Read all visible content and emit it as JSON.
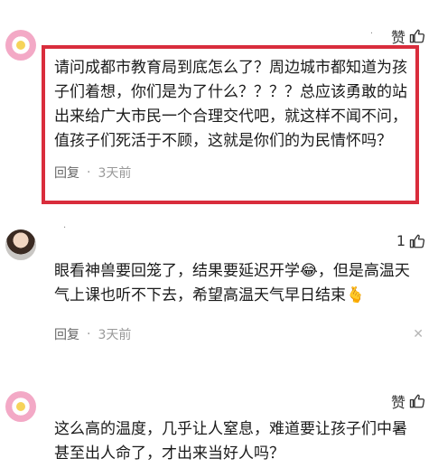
{
  "comments": [
    {
      "like_label": "赞",
      "text_lines": [
        "请问成都市教育局到底怎么了？周边城市都知道为孩",
        "子们着想，你们是为了什么？？？？总应该勇敢的站",
        "出来给广大市民一个合理交代吧，就这样不闻不问，",
        "值孩子们死活于不顾，这就是你们的为民情怀吗？"
      ],
      "reply_label": "回复",
      "dot": "·",
      "time": "3天前"
    },
    {
      "like_label": "1",
      "text_lines": [
        "眼看神兽要回笼了，结果要延迟开学😂，但是高温天",
        "气上课也听不下去，希望高温天气早日结束🫰"
      ],
      "reply_label": "回复",
      "dot": "·",
      "time": "3天前",
      "close": "✕"
    },
    {
      "like_label": "赞",
      "text_lines": [
        "这么高的温度，几乎让人窒息，难道要让孩子们中暑",
        "甚至出人命了，才出来当好人吗？"
      ]
    }
  ],
  "icons": {
    "thumb": "thumbs-up-icon",
    "close": "close-icon"
  },
  "colors": {
    "highlight_border": "#d92d3c",
    "avatar_ring": "#f3a9c6"
  }
}
